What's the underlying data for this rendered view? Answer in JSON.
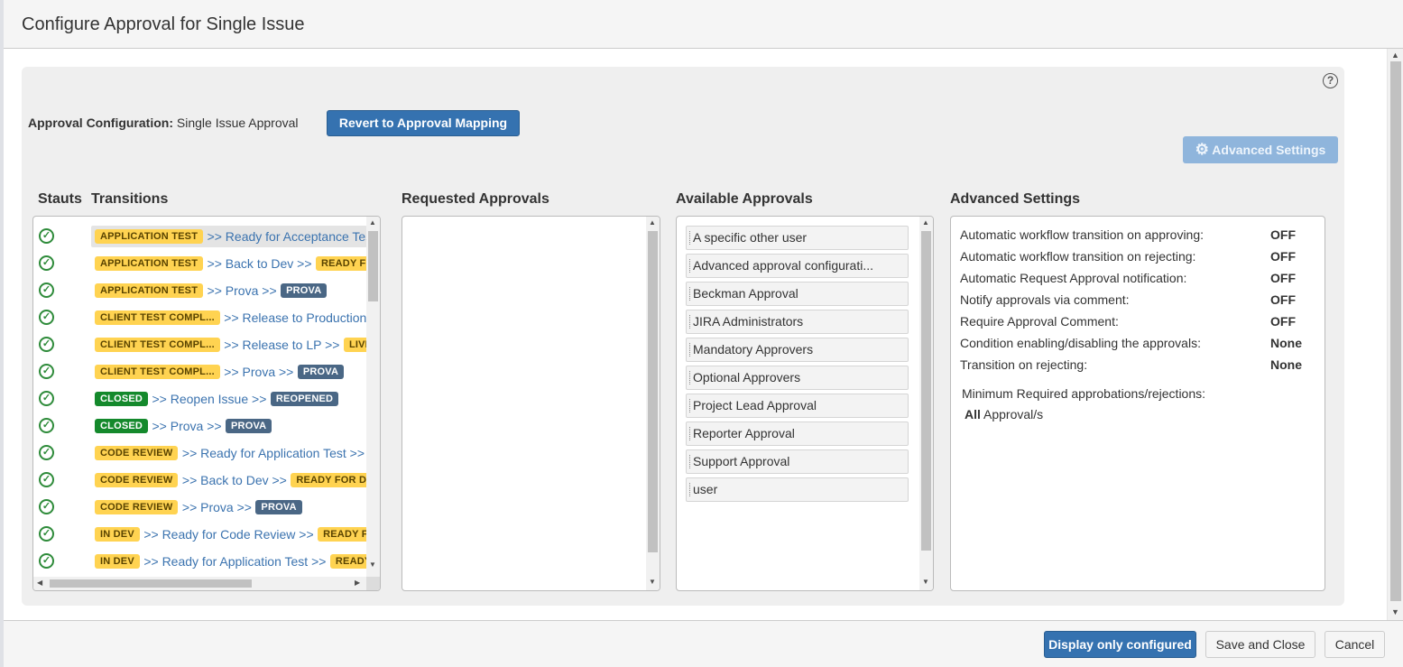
{
  "dialog": {
    "title": "Configure Approval for Single Issue"
  },
  "config": {
    "label": "Approval Configuration:",
    "value": "Single Issue Approval",
    "revert_button": "Revert to Approval Mapping",
    "advanced_button": "Advanced Settings",
    "help_icon": "question-circle-icon"
  },
  "columns": {
    "status": "Stauts",
    "transitions": "Transitions",
    "requested": "Requested Approvals",
    "available": "Available Approvals",
    "advanced": "Advanced Settings"
  },
  "transitions": [
    {
      "from": "APPLICATION TEST",
      "from_color": "yellow",
      "action": ">> Ready for Acceptance Test",
      "to": "",
      "to_color": "",
      "highlighted": true
    },
    {
      "from": "APPLICATION TEST",
      "from_color": "yellow",
      "action": ">> Back to Dev >>",
      "to": "READY FOR DEV",
      "to_color": "yellow"
    },
    {
      "from": "APPLICATION TEST",
      "from_color": "yellow",
      "action": ">> Prova >>",
      "to": "PROVA",
      "to_color": "blue"
    },
    {
      "from": "CLIENT TEST COMPL...",
      "from_color": "yellow",
      "action": ">> Release to Production",
      "to": "",
      "to_color": ""
    },
    {
      "from": "CLIENT TEST COMPL...",
      "from_color": "yellow",
      "action": ">> Release to LP >>",
      "to": "LIVE",
      "to_color": "yellow"
    },
    {
      "from": "CLIENT TEST COMPL...",
      "from_color": "yellow",
      "action": ">> Prova >>",
      "to": "PROVA",
      "to_color": "blue"
    },
    {
      "from": "CLOSED",
      "from_color": "green",
      "action": ">> Reopen Issue >>",
      "to": "REOPENED",
      "to_color": "blue"
    },
    {
      "from": "CLOSED",
      "from_color": "green",
      "action": ">> Prova >>",
      "to": "PROVA",
      "to_color": "blue"
    },
    {
      "from": "CODE REVIEW",
      "from_color": "yellow",
      "action": ">> Ready for Application Test >>",
      "to": "",
      "to_color": ""
    },
    {
      "from": "CODE REVIEW",
      "from_color": "yellow",
      "action": ">> Back to Dev >>",
      "to": "READY FOR DEV",
      "to_color": "yellow"
    },
    {
      "from": "CODE REVIEW",
      "from_color": "yellow",
      "action": ">> Prova >>",
      "to": "PROVA",
      "to_color": "blue"
    },
    {
      "from": "IN DEV",
      "from_color": "yellow",
      "action": ">> Ready for Code Review >>",
      "to": "READY FOR",
      "to_color": "yellow"
    },
    {
      "from": "IN DEV",
      "from_color": "yellow",
      "action": ">> Ready for Application Test >>",
      "to": "READY",
      "to_color": "yellow"
    }
  ],
  "available_approvals": [
    "A specific other user",
    "Advanced approval configurati...",
    "Beckman Approval",
    "JIRA Administrators",
    "Mandatory Approvers",
    "Optional Approvers",
    "Project Lead Approval",
    "Reporter Approval",
    "Support Approval",
    "user"
  ],
  "advanced_settings": [
    {
      "label": "Automatic workflow transition on approving:",
      "value": "OFF"
    },
    {
      "label": "Automatic workflow transition on rejecting:",
      "value": "OFF"
    },
    {
      "label": "Automatic Request Approval notification:",
      "value": "OFF"
    },
    {
      "label": "Notify approvals via comment:",
      "value": "OFF"
    },
    {
      "label": "Require Approval Comment:",
      "value": "OFF"
    },
    {
      "label": "Condition enabling/disabling the approvals:",
      "value": "None"
    },
    {
      "label": "Transition on rejecting:",
      "value": "None"
    }
  ],
  "minimum": {
    "label": "Minimum Required approbations/rejections:",
    "value_bold": "All",
    "value_rest": " Approval/s"
  },
  "footer": {
    "display_button": "Display only configured",
    "save_button": "Save and Close",
    "cancel_button": "Cancel"
  },
  "colors": {
    "primary": "#3572b0",
    "lozenge_yellow": "#ffd351",
    "lozenge_green": "#14892c",
    "lozenge_blue": "#4a6785",
    "link": "#3b73af",
    "status_ok": "#2e8b3a"
  }
}
